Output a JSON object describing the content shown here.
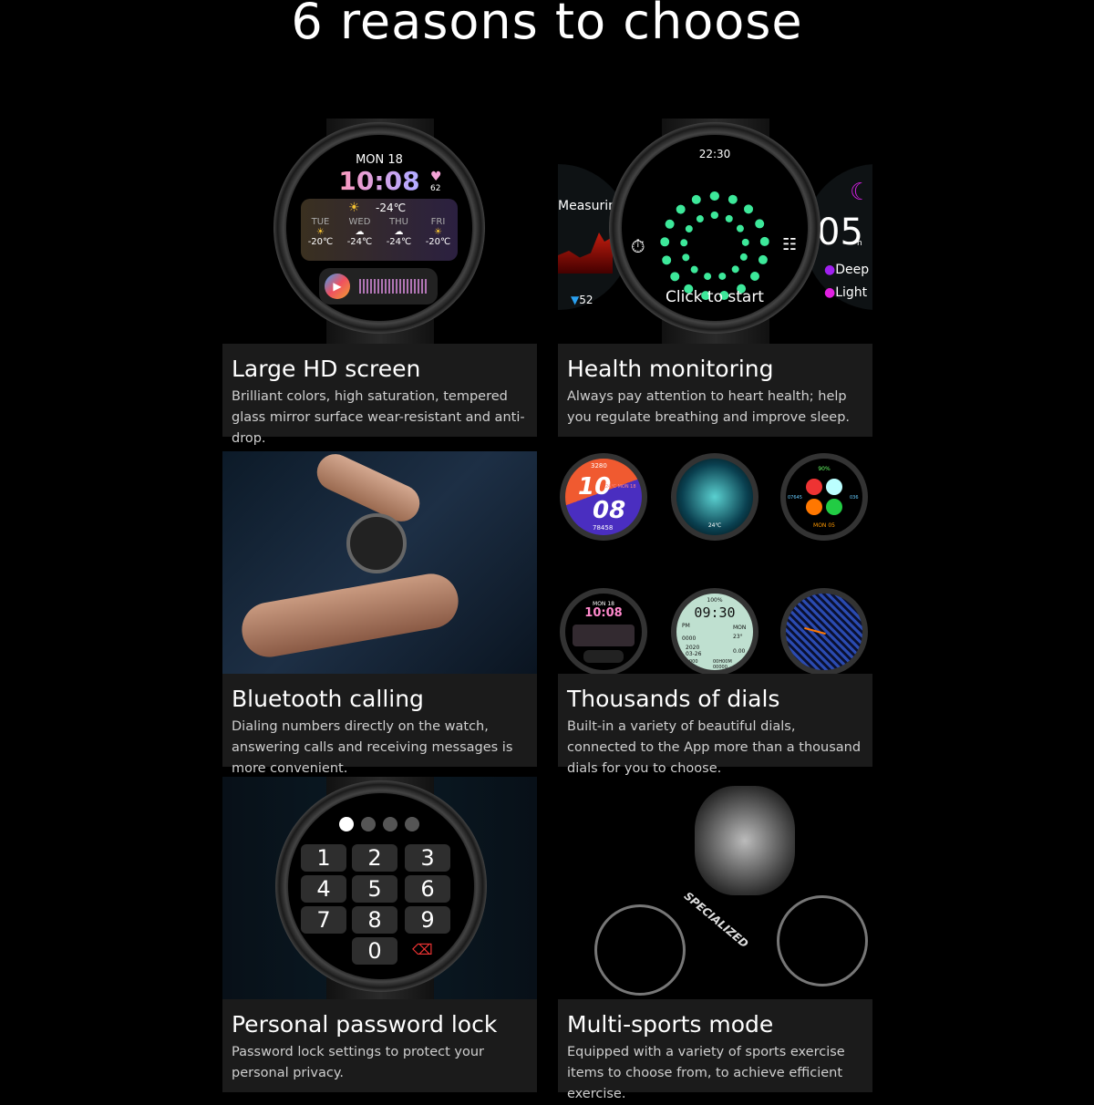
{
  "headline": "6 reasons to choose",
  "features": [
    {
      "title": "Large HD screen",
      "description": "Brilliant colors, high saturation, tempered glass mirror surface wear-resistant and anti-drop."
    },
    {
      "title": "Health monitoring",
      "description": "Always pay attention to heart health; help you regulate breathing and improve sleep."
    },
    {
      "title": "Bluetooth calling",
      "description": "Dialing numbers directly on the watch, answering calls and receiving messages is more convenient."
    },
    {
      "title": "Thousands of dials",
      "description": "Built-in a variety of beautiful dials, connected to the App more than a thousand dials for you to choose."
    },
    {
      "title": "Personal password lock",
      "description": "Password lock settings to protect your personal privacy."
    },
    {
      "title": "Multi-sports mode",
      "description": "Equipped with a variety of sports exercise items to choose from, to achieve efficient exercise."
    }
  ],
  "watch1": {
    "date": "MON 18",
    "time": "10:08",
    "heart_rate": "62",
    "current_temp": "-24℃",
    "forecast": [
      {
        "day": "TUE",
        "temp": "-20℃",
        "icon": "sun-icon"
      },
      {
        "day": "WED",
        "temp": "-24℃",
        "icon": "cloud-icon"
      },
      {
        "day": "THU",
        "temp": "-24℃",
        "icon": "cloud-icon"
      },
      {
        "day": "FRI",
        "temp": "-20℃",
        "icon": "sun-icon"
      }
    ]
  },
  "watch2": {
    "time": "22:30",
    "action": "Click to start",
    "left_label": "Measuring",
    "left_value": "52",
    "sleep_hours": "05",
    "sleep_unit": "h",
    "legend_deep": "Deep",
    "legend_light": "Light",
    "deep_color": "#a020f0",
    "light_color": "#e020e0",
    "breath_color": "#3de89a"
  },
  "dials": [
    {
      "top": "3280",
      "time_h": "10",
      "time_m": "08",
      "info": "24℃ MON 18",
      "bottom": "78458"
    },
    {
      "info": "24℃"
    },
    {
      "percent": "90%",
      "left": "07645",
      "right": "036",
      "date": "MON 05"
    },
    {
      "date": "MON 18",
      "time": "10:08"
    },
    {
      "battery": "100%",
      "time": "09:30",
      "pm": "PM",
      "day": "MON",
      "temp": "23°",
      "steps": "0000",
      "date1": "2020",
      "date2": "03-26",
      "dist": "0.00",
      "a": "000",
      "b": "00H00M",
      "c": "00000"
    },
    {}
  ],
  "keypad": {
    "keys": [
      "1",
      "2",
      "3",
      "4",
      "5",
      "6",
      "7",
      "8",
      "9",
      "0"
    ],
    "pin_dots_filled": 1,
    "pin_dots_total": 4
  },
  "bike_brand": "SPECIALIZED"
}
